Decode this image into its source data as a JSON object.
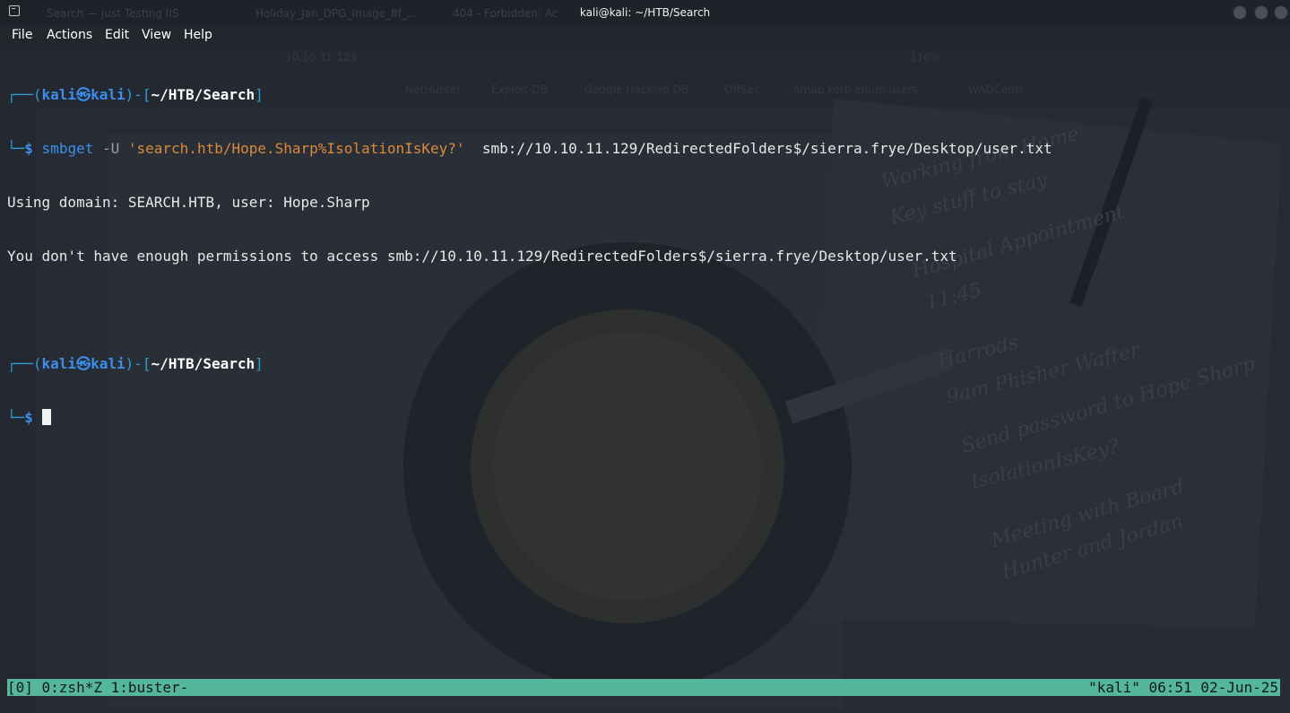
{
  "window": {
    "title": "kali@kali: ~/HTB/Search",
    "background_ghost_tabs": [
      "Search — Just Testing IIS",
      "Holiday_Jan_DPG_Image_8f_...",
      "404 - Forbidden: Ac"
    ]
  },
  "menu": {
    "file": "File",
    "actions": "Actions",
    "edit": "Edit",
    "view": "View",
    "help": "Help"
  },
  "ghost_browser": {
    "address": "10.10.11.129",
    "bookmarks": [
      "NetHunter",
      "Exploit-DB",
      "Google Hacking DB",
      "OffSec",
      "nmap kerb enum users",
      "WADComs"
    ],
    "zoom": "110%"
  },
  "terminal": {
    "prompt1": {
      "frame_open": "┌──(",
      "user": "kali",
      "at": "㉿",
      "host": "kali",
      "frame_mid": ")-[",
      "path": "~/HTB/Search",
      "frame_close": "]",
      "prefix2": "└─",
      "dollar": "$",
      "command": "smbget",
      "flag": " -U ",
      "quoted": "'search.htb/Hope.Sharp%IsolationIsKey?'",
      "target": "  smb://10.10.11.129/RedirectedFolders$/sierra.frye/Desktop/user.txt"
    },
    "output": [
      "Using domain: SEARCH.HTB, user: Hope.Sharp",
      "You don't have enough permissions to access smb://10.10.11.129/RedirectedFolders$/sierra.frye/Desktop/user.txt"
    ],
    "prompt2": {
      "frame_open": "┌──(",
      "user": "kali",
      "at": "㉿",
      "host": "kali",
      "frame_mid": ")-[",
      "path": "~/HTB/Search",
      "frame_close": "]",
      "prefix2": "└─",
      "dollar": "$"
    }
  },
  "wallpaper_notes": [
    "Working from Home",
    "Key stuff to stay",
    "Hospital Appointment",
    "11:45",
    "Harrods",
    "9am Phisher Wafter",
    "Send password to Hope Sharp",
    "IsolationIsKey?",
    "Meeting with Board",
    "Hunter and Jordan"
  ],
  "tmux": {
    "left": "[0] 0:zsh*Z 1:buster-",
    "right": "\"kali\" 06:51 02-Jun-25"
  },
  "colors": {
    "accent_blue": "#3b8eea",
    "string_orange": "#d98b3a",
    "status_green": "#56b69b"
  }
}
